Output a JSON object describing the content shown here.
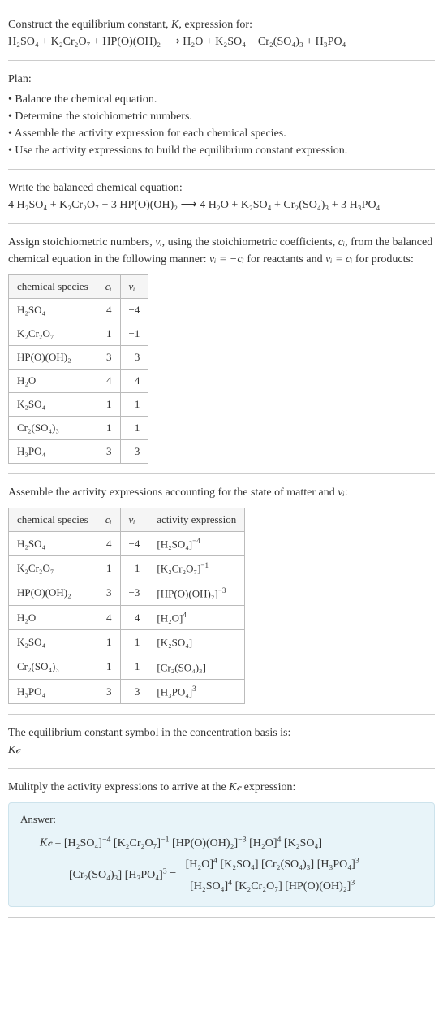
{
  "intro": {
    "line1": "Construct the equilibrium constant, ",
    "K": "K",
    "line1b": ", expression for:",
    "equation": "H₂SO₄ + K₂Cr₂O₇ + HP(O)(OH)₂ ⟶ H₂O + K₂SO₄ + Cr₂(SO₄)₃ + H₃PO₄"
  },
  "plan": {
    "heading": "Plan:",
    "items": [
      "Balance the chemical equation.",
      "Determine the stoichiometric numbers.",
      "Assemble the activity expression for each chemical species.",
      "Use the activity expressions to build the equilibrium constant expression."
    ]
  },
  "balanced": {
    "heading": "Write the balanced chemical equation:",
    "equation": "4 H₂SO₄ + K₂Cr₂O₇ + 3 HP(O)(OH)₂ ⟶ 4 H₂O + K₂SO₄ + Cr₂(SO₄)₃ + 3 H₃PO₄"
  },
  "stoich": {
    "intro_a": "Assign stoichiometric numbers, ",
    "nu_i": "νᵢ",
    "intro_b": ", using the stoichiometric coefficients, ",
    "c_i": "cᵢ",
    "intro_c": ", from the balanced chemical equation in the following manner: ",
    "rel1": "νᵢ = −cᵢ",
    "intro_d": " for reactants and ",
    "rel2": "νᵢ = cᵢ",
    "intro_e": " for products:",
    "headers": {
      "species": "chemical species",
      "c": "cᵢ",
      "nu": "νᵢ"
    },
    "rows": [
      {
        "species": "H₂SO₄",
        "c": "4",
        "nu": "−4"
      },
      {
        "species": "K₂Cr₂O₇",
        "c": "1",
        "nu": "−1"
      },
      {
        "species": "HP(O)(OH)₂",
        "c": "3",
        "nu": "−3"
      },
      {
        "species": "H₂O",
        "c": "4",
        "nu": "4"
      },
      {
        "species": "K₂SO₄",
        "c": "1",
        "nu": "1"
      },
      {
        "species": "Cr₂(SO₄)₃",
        "c": "1",
        "nu": "1"
      },
      {
        "species": "H₃PO₄",
        "c": "3",
        "nu": "3"
      }
    ]
  },
  "activity": {
    "intro_a": "Assemble the activity expressions accounting for the state of matter and ",
    "nu_i": "νᵢ",
    "intro_b": ":",
    "headers": {
      "species": "chemical species",
      "c": "cᵢ",
      "nu": "νᵢ",
      "act": "activity expression"
    },
    "rows": [
      {
        "species": "H₂SO₄",
        "c": "4",
        "nu": "−4",
        "act_base": "[H₂SO₄]",
        "act_exp": "−4"
      },
      {
        "species": "K₂Cr₂O₇",
        "c": "1",
        "nu": "−1",
        "act_base": "[K₂Cr₂O₇]",
        "act_exp": "−1"
      },
      {
        "species": "HP(O)(OH)₂",
        "c": "3",
        "nu": "−3",
        "act_base": "[HP(O)(OH)₂]",
        "act_exp": "−3"
      },
      {
        "species": "H₂O",
        "c": "4",
        "nu": "4",
        "act_base": "[H₂O]",
        "act_exp": "4"
      },
      {
        "species": "K₂SO₄",
        "c": "1",
        "nu": "1",
        "act_base": "[K₂SO₄]",
        "act_exp": ""
      },
      {
        "species": "Cr₂(SO₄)₃",
        "c": "1",
        "nu": "1",
        "act_base": "[Cr₂(SO₄)₃]",
        "act_exp": ""
      },
      {
        "species": "H₃PO₄",
        "c": "3",
        "nu": "3",
        "act_base": "[H₃PO₄]",
        "act_exp": "3"
      }
    ]
  },
  "symbol": {
    "line": "The equilibrium constant symbol in the concentration basis is:",
    "kc": "K𝒸"
  },
  "multiply": {
    "line_a": "Mulitply the activity expressions to arrive at the ",
    "kc": "K𝒸",
    "line_b": " expression:"
  },
  "answer": {
    "label": "Answer:",
    "kc": "K𝒸",
    "eq": " = ",
    "t1": {
      "b": "[H₂SO₄]",
      "e": "−4"
    },
    "t2": {
      "b": "[K₂Cr₂O₇]",
      "e": "−1"
    },
    "t3": {
      "b": "[HP(O)(OH)₂]",
      "e": "−3"
    },
    "t4": {
      "b": "[H₂O]",
      "e": "4"
    },
    "t5": {
      "b": "[K₂SO₄]",
      "e": ""
    },
    "t6": {
      "b": "[Cr₂(SO₄)₃]",
      "e": ""
    },
    "t7": {
      "b": "[H₃PO₄]",
      "e": "3"
    },
    "eq2": " = ",
    "num": {
      "a": {
        "b": "[H₂O]",
        "e": "4"
      },
      "b": {
        "b": "[K₂SO₄]",
        "e": ""
      },
      "c": {
        "b": "[Cr₂(SO₄)₃]",
        "e": ""
      },
      "d": {
        "b": "[H₃PO₄]",
        "e": "3"
      }
    },
    "den": {
      "a": {
        "b": "[H₂SO₄]",
        "e": "4"
      },
      "b": {
        "b": "[K₂Cr₂O₇]",
        "e": ""
      },
      "c": {
        "b": "[HP(O)(OH)₂]",
        "e": "3"
      }
    }
  }
}
